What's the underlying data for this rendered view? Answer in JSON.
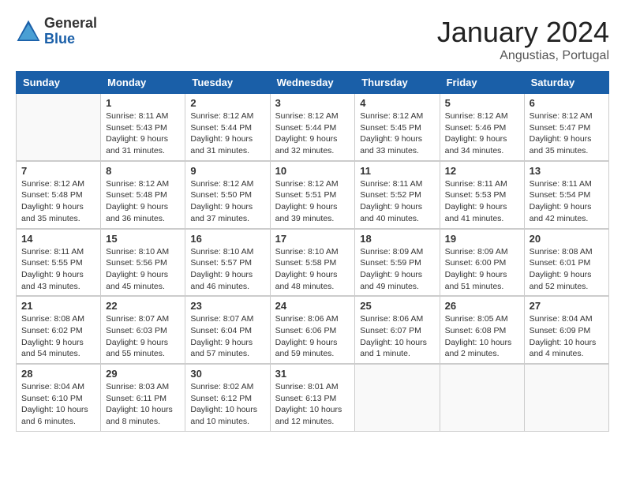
{
  "header": {
    "logo_general": "General",
    "logo_blue": "Blue",
    "month_title": "January 2024",
    "subtitle": "Angustias, Portugal"
  },
  "weekdays": [
    "Sunday",
    "Monday",
    "Tuesday",
    "Wednesday",
    "Thursday",
    "Friday",
    "Saturday"
  ],
  "weeks": [
    [
      {
        "day": "",
        "info": ""
      },
      {
        "day": "1",
        "info": "Sunrise: 8:11 AM\nSunset: 5:43 PM\nDaylight: 9 hours\nand 31 minutes."
      },
      {
        "day": "2",
        "info": "Sunrise: 8:12 AM\nSunset: 5:44 PM\nDaylight: 9 hours\nand 31 minutes."
      },
      {
        "day": "3",
        "info": "Sunrise: 8:12 AM\nSunset: 5:44 PM\nDaylight: 9 hours\nand 32 minutes."
      },
      {
        "day": "4",
        "info": "Sunrise: 8:12 AM\nSunset: 5:45 PM\nDaylight: 9 hours\nand 33 minutes."
      },
      {
        "day": "5",
        "info": "Sunrise: 8:12 AM\nSunset: 5:46 PM\nDaylight: 9 hours\nand 34 minutes."
      },
      {
        "day": "6",
        "info": "Sunrise: 8:12 AM\nSunset: 5:47 PM\nDaylight: 9 hours\nand 35 minutes."
      }
    ],
    [
      {
        "day": "7",
        "info": ""
      },
      {
        "day": "8",
        "info": "Sunrise: 8:12 AM\nSunset: 5:48 PM\nDaylight: 9 hours\nand 36 minutes."
      },
      {
        "day": "9",
        "info": "Sunrise: 8:12 AM\nSunset: 5:50 PM\nDaylight: 9 hours\nand 37 minutes."
      },
      {
        "day": "10",
        "info": "Sunrise: 8:12 AM\nSunset: 5:51 PM\nDaylight: 9 hours\nand 39 minutes."
      },
      {
        "day": "11",
        "info": "Sunrise: 8:11 AM\nSunset: 5:52 PM\nDaylight: 9 hours\nand 40 minutes."
      },
      {
        "day": "12",
        "info": "Sunrise: 8:11 AM\nSunset: 5:53 PM\nDaylight: 9 hours\nand 41 minutes."
      },
      {
        "day": "13",
        "info": "Sunrise: 8:11 AM\nSunset: 5:54 PM\nDaylight: 9 hours\nand 42 minutes."
      }
    ],
    [
      {
        "day": "14",
        "info": ""
      },
      {
        "day": "15",
        "info": "Sunrise: 8:10 AM\nSunset: 5:56 PM\nDaylight: 9 hours\nand 45 minutes."
      },
      {
        "day": "16",
        "info": "Sunrise: 8:10 AM\nSunset: 5:57 PM\nDaylight: 9 hours\nand 46 minutes."
      },
      {
        "day": "17",
        "info": "Sunrise: 8:10 AM\nSunset: 5:58 PM\nDaylight: 9 hours\nand 48 minutes."
      },
      {
        "day": "18",
        "info": "Sunrise: 8:09 AM\nSunset: 5:59 PM\nDaylight: 9 hours\nand 49 minutes."
      },
      {
        "day": "19",
        "info": "Sunrise: 8:09 AM\nSunset: 6:00 PM\nDaylight: 9 hours\nand 51 minutes."
      },
      {
        "day": "20",
        "info": "Sunrise: 8:08 AM\nSunset: 6:01 PM\nDaylight: 9 hours\nand 52 minutes."
      }
    ],
    [
      {
        "day": "21",
        "info": ""
      },
      {
        "day": "22",
        "info": "Sunrise: 8:07 AM\nSunset: 6:03 PM\nDaylight: 9 hours\nand 55 minutes."
      },
      {
        "day": "23",
        "info": "Sunrise: 8:07 AM\nSunset: 6:04 PM\nDaylight: 9 hours\nand 57 minutes."
      },
      {
        "day": "24",
        "info": "Sunrise: 8:06 AM\nSunset: 6:06 PM\nDaylight: 9 hours\nand 59 minutes."
      },
      {
        "day": "25",
        "info": "Sunrise: 8:06 AM\nSunset: 6:07 PM\nDaylight: 10 hours\nand 1 minute."
      },
      {
        "day": "26",
        "info": "Sunrise: 8:05 AM\nSunset: 6:08 PM\nDaylight: 10 hours\nand 2 minutes."
      },
      {
        "day": "27",
        "info": "Sunrise: 8:04 AM\nSunset: 6:09 PM\nDaylight: 10 hours\nand 4 minutes."
      }
    ],
    [
      {
        "day": "28",
        "info": ""
      },
      {
        "day": "29",
        "info": "Sunrise: 8:03 AM\nSunset: 6:11 PM\nDaylight: 10 hours\nand 8 minutes."
      },
      {
        "day": "30",
        "info": "Sunrise: 8:02 AM\nSunset: 6:12 PM\nDaylight: 10 hours\nand 10 minutes."
      },
      {
        "day": "31",
        "info": "Sunrise: 8:01 AM\nSunset: 6:13 PM\nDaylight: 10 hours\nand 12 minutes."
      },
      {
        "day": "",
        "info": ""
      },
      {
        "day": "",
        "info": ""
      },
      {
        "day": "",
        "info": ""
      }
    ]
  ],
  "week0_day7_info": "Sunrise: 8:12 AM\nSunset: 5:48 PM\nDaylight: 9 hours\nand 35 minutes.",
  "week1_day0_info": "Sunrise: 8:12 AM\nSunset: 5:48 PM\nDaylight: 9 hours\nand 35 minutes.",
  "week2_day0_info": "Sunrise: 8:11 AM\nSunset: 5:55 PM\nDaylight: 9 hours\nand 43 minutes.",
  "week3_day0_info": "Sunrise: 8:08 AM\nSunset: 6:02 PM\nDaylight: 9 hours\nand 54 minutes.",
  "week4_day0_info": "Sunrise: 8:04 AM\nSunset: 6:10 PM\nDaylight: 10 hours\nand 6 minutes."
}
